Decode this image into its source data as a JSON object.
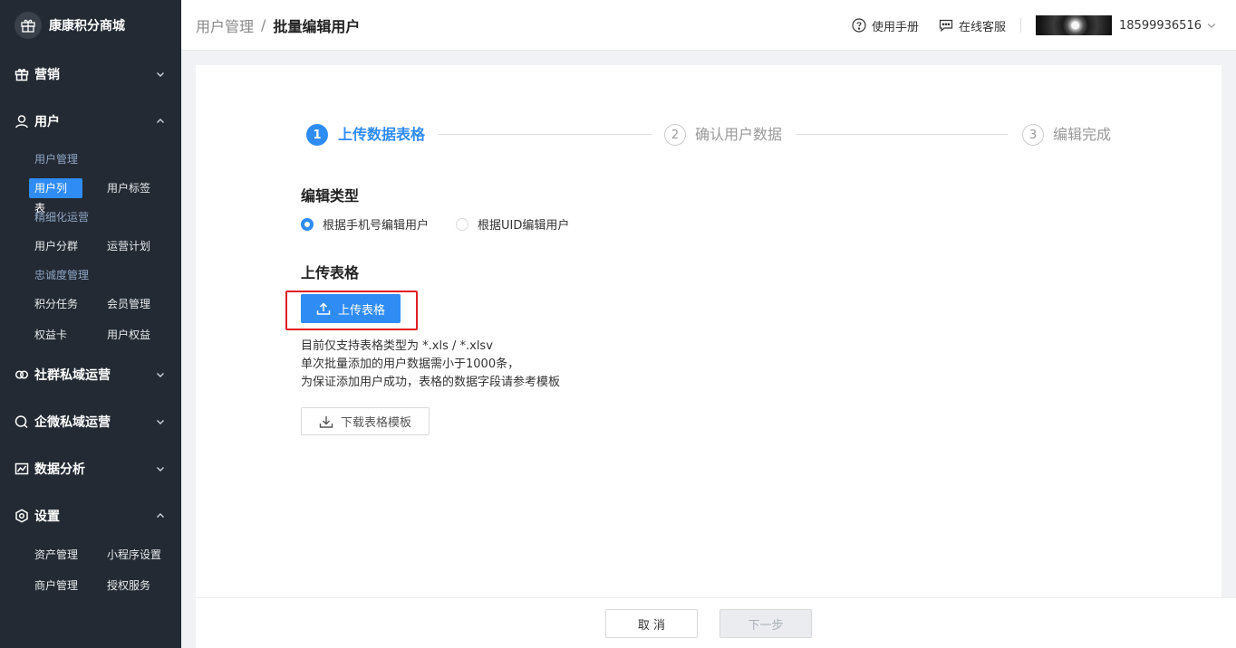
{
  "brand": {
    "name": "康康积分商城",
    "logo_icon": "gift-icon"
  },
  "sidebar": {
    "groups": {
      "marketing": {
        "label": "营销",
        "icon": "gift-icon"
      },
      "user": {
        "label": "用户",
        "icon": "user-icon"
      },
      "community": {
        "label": "社群私域运营",
        "icon": "community-icon"
      },
      "wecom": {
        "label": "企微私域运营",
        "icon": "wecom-icon"
      },
      "analytics": {
        "label": "数据分析",
        "icon": "chart-icon"
      },
      "settings": {
        "label": "设置",
        "icon": "settings-icon"
      }
    },
    "user_sections": {
      "user_mgmt": "用户管理",
      "user_list": "用户列表",
      "user_tags": "用户标签",
      "fine_ops": "精细化运营",
      "user_segments": "用户分群",
      "ops_plan": "运营计划",
      "loyalty": "忠诚度管理",
      "points_tasks": "积分任务",
      "member_mgmt": "会员管理",
      "benefit_card": "权益卡",
      "user_benefits": "用户权益"
    },
    "settings_sections": {
      "asset_mgmt": "资产管理",
      "miniapp": "小程序设置",
      "merchant": "商户管理",
      "auth_service": "授权服务"
    }
  },
  "header": {
    "breadcrumb_parent": "用户管理",
    "breadcrumb_sep": "/",
    "breadcrumb_current": "批量编辑用户",
    "manual_label": "使用手册",
    "support_label": "在线客服",
    "phone": "18599936516"
  },
  "steps": [
    {
      "num": "1",
      "label": "上传数据表格"
    },
    {
      "num": "2",
      "label": "确认用户数据"
    },
    {
      "num": "3",
      "label": "编辑完成"
    }
  ],
  "form": {
    "edit_type_title": "编辑类型",
    "radio_phone": "根据手机号编辑用户",
    "radio_uid": "根据UID编辑用户",
    "upload_title": "上传表格",
    "upload_button": "上传表格",
    "hint_line1": "目前仅支持表格类型为 *.xls / *.xlsv",
    "hint_line2": "单次批量添加的用户数据需小于1000条，",
    "hint_line3": "为保证添加用户成功，表格的数据字段请参考模板",
    "download_button": "下载表格模板"
  },
  "footer": {
    "cancel_label": "取 消",
    "next_label": "下一步"
  },
  "colors": {
    "sidebar_bg": "#232a33",
    "accent": "#2f8cf5",
    "highlight": "#e02020"
  }
}
